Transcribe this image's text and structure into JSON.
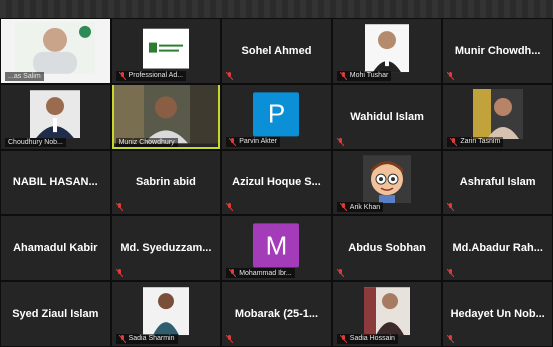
{
  "colors": {
    "tile_bg": "#252526",
    "active_border": "#c7d82b",
    "mute_red": "#e03b3b",
    "avatar_blue": "#0b8fd6",
    "avatar_purple": "#a43bb8"
  },
  "participants": [
    {
      "id": "p1",
      "tag": "...as Salim",
      "kind": "video",
      "muted": false
    },
    {
      "id": "p2",
      "tag": "Professional Ad...",
      "kind": "video-logo",
      "muted": true
    },
    {
      "id": "p3",
      "name": "Sohel Ahmed",
      "kind": "name",
      "muted": true
    },
    {
      "id": "p4",
      "tag": "Mohi Tushar",
      "kind": "video-photo",
      "muted": true
    },
    {
      "id": "p5",
      "name": "Munir Chowdh...",
      "kind": "name",
      "muted": true
    },
    {
      "id": "p6",
      "tag": "Choudhury Nob...",
      "kind": "video-photo",
      "muted": false
    },
    {
      "id": "p7",
      "tag": "Muniz Chowdhury",
      "kind": "video",
      "muted": false,
      "active": true
    },
    {
      "id": "p8",
      "tag": "Parvin Akter",
      "kind": "avatar",
      "letter": "P",
      "avatar_color": "#0b8fd6",
      "muted": true
    },
    {
      "id": "p9",
      "name": "Wahidul Islam",
      "kind": "name",
      "muted": true
    },
    {
      "id": "p10",
      "tag": "Zarin Tasnim",
      "kind": "video-photo",
      "muted": true
    },
    {
      "id": "p11",
      "name": "NABIL HASAN...",
      "kind": "name",
      "muted": false
    },
    {
      "id": "p12",
      "name": "Sabrin abid",
      "kind": "name",
      "muted": true
    },
    {
      "id": "p13",
      "name": "Azizul Hoque S...",
      "kind": "name",
      "muted": true
    },
    {
      "id": "p14",
      "tag": "Arik Khan",
      "kind": "cartoon",
      "muted": true
    },
    {
      "id": "p15",
      "name": "Ashraful Islam",
      "kind": "name",
      "muted": true
    },
    {
      "id": "p16",
      "name": "Ahamadul Kabir",
      "kind": "name",
      "muted": false
    },
    {
      "id": "p17",
      "name": "Md. Syeduzzam...",
      "kind": "name",
      "muted": true
    },
    {
      "id": "p18",
      "tag": "Mohammad Ibr...",
      "kind": "avatar",
      "letter": "M",
      "avatar_color": "#a43bb8",
      "muted": true
    },
    {
      "id": "p19",
      "name": "Abdus Sobhan",
      "kind": "name",
      "muted": true
    },
    {
      "id": "p20",
      "name": "Md.Abadur Rah...",
      "kind": "name",
      "muted": true
    },
    {
      "id": "p21",
      "name": "Syed Ziaul Islam",
      "kind": "name",
      "muted": false
    },
    {
      "id": "p22",
      "tag": "Sadia Sharmin",
      "kind": "video-photo",
      "muted": true
    },
    {
      "id": "p23",
      "name": "Mobarak (25-1...",
      "kind": "name",
      "muted": true
    },
    {
      "id": "p24",
      "tag": "Sadia Hossain",
      "kind": "video-photo",
      "muted": true
    },
    {
      "id": "p25",
      "name": "Hedayet Un Nob...",
      "kind": "name",
      "muted": true
    }
  ]
}
